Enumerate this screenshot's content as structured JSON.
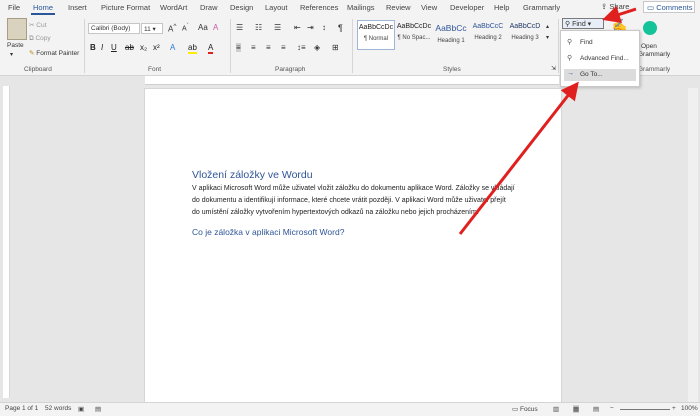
{
  "tabs": [
    "File",
    "Home",
    "Insert",
    "Picture Format",
    "WordArt",
    "Draw",
    "Design",
    "Layout",
    "References",
    "Mailings",
    "Review",
    "View",
    "Developer",
    "Help",
    "Grammarly"
  ],
  "share": "Share",
  "comments": "Comments",
  "clipboard": {
    "paste": "Paste",
    "cut": "Cut",
    "copy": "Copy",
    "format_painter": "Format Painter",
    "label": "Clipboard"
  },
  "font": {
    "name": "Calibri (Body)",
    "size": "11",
    "label": "Font"
  },
  "paragraph": {
    "label": "Paragraph"
  },
  "styles": {
    "items": [
      {
        "sample": "AaBbCcDc",
        "name": "¶ Normal"
      },
      {
        "sample": "AaBbCcDc",
        "name": "¶ No Spac..."
      },
      {
        "sample": "AaBbCc",
        "name": "Heading 1"
      },
      {
        "sample": "AaBbCcC",
        "name": "Heading 2"
      },
      {
        "sample": "AaBbCcD",
        "name": "Heading 3"
      }
    ],
    "label": "Styles"
  },
  "editing": {
    "find": "Find"
  },
  "find_menu": {
    "find": "Find",
    "advanced": "Advanced Find...",
    "goto": "Go To..."
  },
  "grammarly": {
    "open": "Open",
    "sub": "Grammarly",
    "label": "Grammarly"
  },
  "document": {
    "title": "Vložení záložky ve Wordu",
    "para": [
      "V aplikaci Microsoft Word může uživatel vložit záložku do dokumentu aplikace Word. Záložky se vkládají",
      "do dokumentu a identifikují informace, které chcete vrátit později. V aplikaci Word může uživatel přejít",
      "do umístění záložky vytvořením hypertextových odkazů na záložku nebo jejich procházením."
    ],
    "heading2": "Co je záložka v aplikaci Microsoft Word?"
  },
  "status": {
    "page": "Page 1 of 1",
    "words": "52 words",
    "focus": "Focus",
    "zoom": "100%"
  },
  "colors": {
    "accent": "#2b579a",
    "arrow": "#e0201f",
    "heading": "#2e5597"
  }
}
